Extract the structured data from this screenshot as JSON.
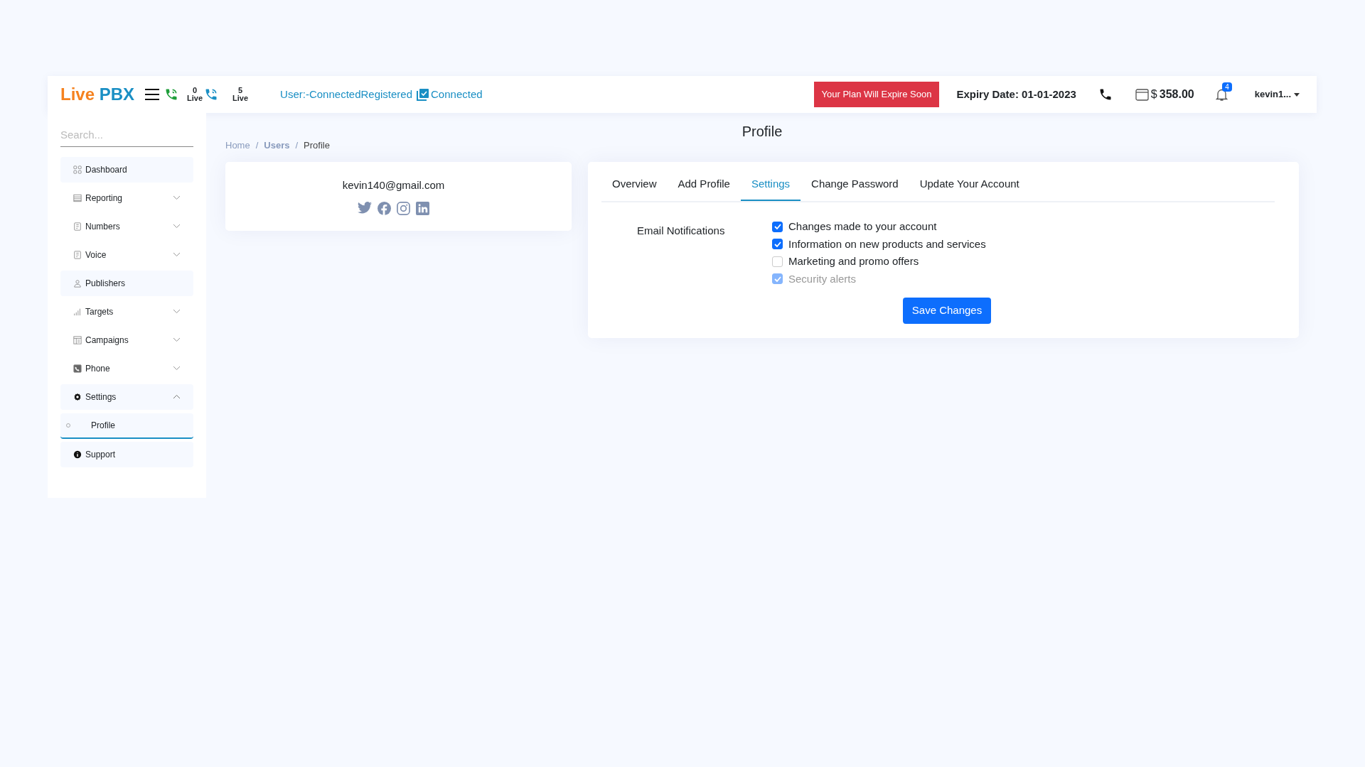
{
  "header": {
    "logo_first": "Live",
    "logo_second": "PBX",
    "live_counters": [
      {
        "count": "0",
        "label": "Live"
      },
      {
        "count": "5",
        "label": "Live"
      }
    ],
    "status_text": "User:-ConnectedRegistered",
    "status_connected": "Connected",
    "plan_button": "Your Plan Will Expire Soon",
    "expiry": "Expiry Date: 01-01-2023",
    "currency": "$",
    "balance": "358.00",
    "notification_count": "4",
    "user": "kevin1..."
  },
  "sidebar": {
    "search": {
      "placeholder": "Search..."
    },
    "items": [
      {
        "label": "Dashboard",
        "kind": "link"
      },
      {
        "label": "Reporting",
        "kind": "dropdown",
        "expanded": false
      },
      {
        "label": "Numbers",
        "kind": "dropdown",
        "expanded": false
      },
      {
        "label": "Voice",
        "kind": "dropdown",
        "expanded": false
      },
      {
        "label": "Publishers",
        "kind": "link"
      },
      {
        "label": "Targets",
        "kind": "dropdown",
        "expanded": false
      },
      {
        "label": "Campaigns",
        "kind": "dropdown",
        "expanded": false
      },
      {
        "label": "Phone",
        "kind": "dropdown",
        "expanded": false
      },
      {
        "label": "Settings",
        "kind": "dropdown",
        "expanded": true,
        "children": [
          {
            "label": "Profile",
            "selected": true
          }
        ]
      },
      {
        "label": "Support",
        "kind": "link"
      }
    ]
  },
  "page_title": "Profile",
  "breadcrumb": [
    {
      "label": "Home"
    },
    {
      "separator": "/",
      "label": "Users"
    },
    {
      "separator": "/",
      "label": "Profile"
    }
  ],
  "profile_card": {
    "email": "kevin140@gmail.com"
  },
  "tabs": [
    {
      "label": "Overview",
      "selected": false
    },
    {
      "label": "Add Profile",
      "selected": false
    },
    {
      "label": "Settings",
      "selected": true
    },
    {
      "label": "Change Password",
      "selected": false
    },
    {
      "label": "Update Your Account",
      "selected": false
    }
  ],
  "settings": {
    "label": "Email Notifications",
    "options": [
      {
        "label": "Changes made to your account",
        "checked": true,
        "disabled": false
      },
      {
        "label": "Information on new products and services",
        "checked": true,
        "disabled": false
      },
      {
        "label": "Marketing and promo offers",
        "checked": false,
        "disabled": false
      },
      {
        "label": "Security alerts",
        "checked": true,
        "disabled": true
      }
    ],
    "save_button": "Save Changes"
  }
}
